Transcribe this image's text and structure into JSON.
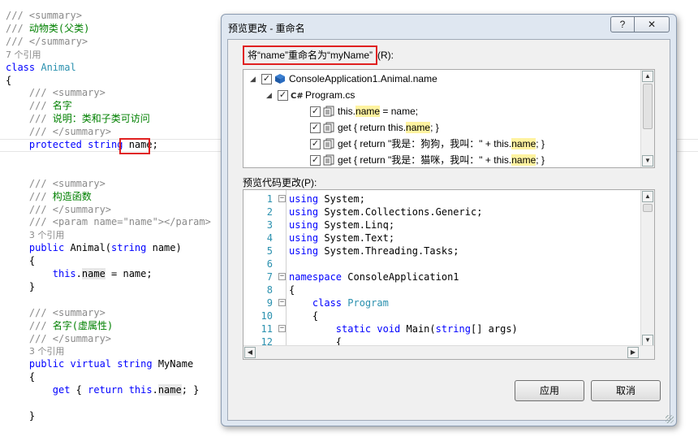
{
  "editor": {
    "lines": [
      {
        "indent": 0,
        "tokens": [
          {
            "t": "/// <summary>",
            "c": "c-comment"
          }
        ]
      },
      {
        "indent": 0,
        "tokens": [
          {
            "t": "/// ",
            "c": "c-comment"
          },
          {
            "t": "动物类(父类)",
            "c": "c-green"
          }
        ]
      },
      {
        "indent": 0,
        "tokens": [
          {
            "t": "/// </summary>",
            "c": "c-comment"
          }
        ]
      },
      {
        "indent": 0,
        "tokens": [
          {
            "t": "7 个引用",
            "c": "c-ref"
          }
        ]
      },
      {
        "indent": 0,
        "tokens": [
          {
            "t": "class ",
            "c": "c-kw"
          },
          {
            "t": "Animal",
            "c": "c-type"
          }
        ]
      },
      {
        "indent": 0,
        "tokens": [
          {
            "t": "{",
            "c": "c-plain"
          }
        ]
      },
      {
        "indent": 4,
        "tokens": [
          {
            "t": "/// <summary>",
            "c": "c-comment"
          }
        ]
      },
      {
        "indent": 4,
        "tokens": [
          {
            "t": "/// ",
            "c": "c-comment"
          },
          {
            "t": "名字",
            "c": "c-green"
          }
        ]
      },
      {
        "indent": 4,
        "tokens": [
          {
            "t": "/// ",
            "c": "c-comment"
          },
          {
            "t": "说明：类和子类可访问",
            "c": "c-green"
          }
        ]
      },
      {
        "indent": 4,
        "tokens": [
          {
            "t": "/// </summary>",
            "c": "c-comment"
          }
        ]
      },
      {
        "indent": 4,
        "tokens": [
          {
            "t": "protected ",
            "c": "c-kw"
          },
          {
            "t": "string ",
            "c": "c-kw"
          },
          {
            "t": "name",
            "c": "c-plain"
          },
          {
            "t": ";",
            "c": "c-plain"
          }
        ]
      },
      {
        "indent": 0,
        "tokens": []
      },
      {
        "indent": 0,
        "tokens": []
      },
      {
        "indent": 4,
        "tokens": [
          {
            "t": "/// <summary>",
            "c": "c-comment"
          }
        ]
      },
      {
        "indent": 4,
        "tokens": [
          {
            "t": "/// ",
            "c": "c-comment"
          },
          {
            "t": "构造函数",
            "c": "c-green"
          }
        ]
      },
      {
        "indent": 4,
        "tokens": [
          {
            "t": "/// </summary>",
            "c": "c-comment"
          }
        ]
      },
      {
        "indent": 4,
        "tokens": [
          {
            "t": "/// <param name=\"name\"></param>",
            "c": "c-comment"
          }
        ]
      },
      {
        "indent": 4,
        "tokens": [
          {
            "t": "3 个引用",
            "c": "c-ref"
          }
        ]
      },
      {
        "indent": 4,
        "tokens": [
          {
            "t": "public ",
            "c": "c-kw"
          },
          {
            "t": "Animal(",
            "c": "c-plain"
          },
          {
            "t": "string ",
            "c": "c-kw"
          },
          {
            "t": "name)",
            "c": "c-plain"
          }
        ]
      },
      {
        "indent": 4,
        "tokens": [
          {
            "t": "{",
            "c": "c-plain"
          }
        ]
      },
      {
        "indent": 8,
        "tokens": [
          {
            "t": "this",
            "c": "c-kw"
          },
          {
            "t": ".",
            "c": "c-plain"
          },
          {
            "t": "name",
            "c": "c-plain hl-ref"
          },
          {
            "t": " = name;",
            "c": "c-plain"
          }
        ]
      },
      {
        "indent": 4,
        "tokens": [
          {
            "t": "}",
            "c": "c-plain"
          }
        ]
      },
      {
        "indent": 0,
        "tokens": []
      },
      {
        "indent": 4,
        "tokens": [
          {
            "t": "/// <summary>",
            "c": "c-comment"
          }
        ]
      },
      {
        "indent": 4,
        "tokens": [
          {
            "t": "/// ",
            "c": "c-comment"
          },
          {
            "t": "名字(虚属性)",
            "c": "c-green"
          }
        ]
      },
      {
        "indent": 4,
        "tokens": [
          {
            "t": "/// </summary>",
            "c": "c-comment"
          }
        ]
      },
      {
        "indent": 4,
        "tokens": [
          {
            "t": "3 个引用",
            "c": "c-ref"
          }
        ]
      },
      {
        "indent": 4,
        "tokens": [
          {
            "t": "public ",
            "c": "c-kw"
          },
          {
            "t": "virtual ",
            "c": "c-kw"
          },
          {
            "t": "string ",
            "c": "c-kw"
          },
          {
            "t": "MyName",
            "c": "c-plain"
          }
        ]
      },
      {
        "indent": 4,
        "tokens": [
          {
            "t": "{",
            "c": "c-plain"
          }
        ]
      },
      {
        "indent": 8,
        "tokens": [
          {
            "t": "get ",
            "c": "c-kw"
          },
          {
            "t": "{ ",
            "c": "c-plain"
          },
          {
            "t": "return ",
            "c": "c-kw"
          },
          {
            "t": "this",
            "c": "c-kw"
          },
          {
            "t": ".",
            "c": "c-plain"
          },
          {
            "t": "name",
            "c": "c-plain hl-ref"
          },
          {
            "t": "; }",
            "c": "c-plain"
          }
        ]
      },
      {
        "indent": 4,
        "tokens": [
          {
            "t": "",
            "c": "c-plain"
          }
        ]
      },
      {
        "indent": 4,
        "tokens": [
          {
            "t": "}",
            "c": "c-plain"
          }
        ]
      }
    ]
  },
  "dialog": {
    "title": "预览更改 - 重命名",
    "help_label": "?",
    "close_label": "✕",
    "rename_prefix": "将“name”重命名为“myName”",
    "rename_suffix": "(R):",
    "tree": [
      {
        "level": 0,
        "arrow": "◢",
        "checked": true,
        "icon": "field-icon",
        "parts": [
          {
            "t": "ConsoleApplication1.Animal.name",
            "h": false
          }
        ]
      },
      {
        "level": 1,
        "arrow": "◢",
        "checked": true,
        "icon": "csharp-file-icon",
        "parts": [
          {
            "t": "Program.cs",
            "h": false
          }
        ]
      },
      {
        "level": 2,
        "arrow": "",
        "checked": true,
        "icon": "code-line-icon",
        "parts": [
          {
            "t": "this.",
            "h": false
          },
          {
            "t": "name",
            "h": true
          },
          {
            "t": " = name;",
            "h": false
          }
        ]
      },
      {
        "level": 2,
        "arrow": "",
        "checked": true,
        "icon": "code-line-icon",
        "parts": [
          {
            "t": "get { return this.",
            "h": false
          },
          {
            "t": "name",
            "h": true
          },
          {
            "t": "; }",
            "h": false
          }
        ]
      },
      {
        "level": 2,
        "arrow": "",
        "checked": true,
        "icon": "code-line-icon",
        "parts": [
          {
            "t": "get { return \"我是：狗狗，我叫：\" + this.",
            "h": false
          },
          {
            "t": "name",
            "h": true
          },
          {
            "t": "; }",
            "h": false
          }
        ]
      },
      {
        "level": 2,
        "arrow": "",
        "checked": true,
        "icon": "code-line-icon",
        "parts": [
          {
            "t": "get { return \"我是：猫咪，我叫：\" + this.",
            "h": false
          },
          {
            "t": "name",
            "h": true
          },
          {
            "t": "; }",
            "h": false
          }
        ]
      }
    ],
    "preview_label": "预览代码更改(P):",
    "preview_lines": [
      {
        "n": "1",
        "fold": "−",
        "tokens": [
          {
            "t": "using",
            "c": "c-kw"
          },
          {
            "t": " System;",
            "c": "c-plain"
          }
        ]
      },
      {
        "n": "2",
        "fold": "",
        "tokens": [
          {
            "t": "using",
            "c": "c-kw"
          },
          {
            "t": " System.Collections.Generic;",
            "c": "c-plain"
          }
        ]
      },
      {
        "n": "3",
        "fold": "",
        "tokens": [
          {
            "t": "using",
            "c": "c-kw"
          },
          {
            "t": " System.Linq;",
            "c": "c-plain"
          }
        ]
      },
      {
        "n": "4",
        "fold": "",
        "tokens": [
          {
            "t": "using",
            "c": "c-kw"
          },
          {
            "t": " System.Text;",
            "c": "c-plain"
          }
        ]
      },
      {
        "n": "5",
        "fold": "",
        "tokens": [
          {
            "t": "using",
            "c": "c-kw"
          },
          {
            "t": " System.Threading.Tasks;",
            "c": "c-plain"
          }
        ]
      },
      {
        "n": "6",
        "fold": "",
        "tokens": []
      },
      {
        "n": "7",
        "fold": "−",
        "tokens": [
          {
            "t": "namespace",
            "c": "c-kw"
          },
          {
            "t": " ConsoleApplication1",
            "c": "c-plain"
          }
        ]
      },
      {
        "n": "8",
        "fold": "",
        "tokens": [
          {
            "t": "{",
            "c": "c-plain"
          }
        ]
      },
      {
        "n": "9",
        "fold": "−",
        "tokens": [
          {
            "t": "    class ",
            "c": "c-kw"
          },
          {
            "t": "Program",
            "c": "c-type"
          }
        ]
      },
      {
        "n": "10",
        "fold": "",
        "tokens": [
          {
            "t": "    {",
            "c": "c-plain"
          }
        ]
      },
      {
        "n": "11",
        "fold": "−",
        "tokens": [
          {
            "t": "        static ",
            "c": "c-kw"
          },
          {
            "t": "void ",
            "c": "c-kw"
          },
          {
            "t": "Main(",
            "c": "c-plain"
          },
          {
            "t": "string",
            "c": "c-kw"
          },
          {
            "t": "[] args)",
            "c": "c-plain"
          }
        ]
      },
      {
        "n": "12",
        "fold": "",
        "tokens": [
          {
            "t": "        {",
            "c": "c-plain"
          }
        ]
      }
    ],
    "apply_label": "应用",
    "cancel_label": "取消",
    "colors": {
      "highlight": "#fff3a0",
      "annotation": "#e02020",
      "keyword": "#0000ff",
      "type": "#2b91af"
    }
  }
}
